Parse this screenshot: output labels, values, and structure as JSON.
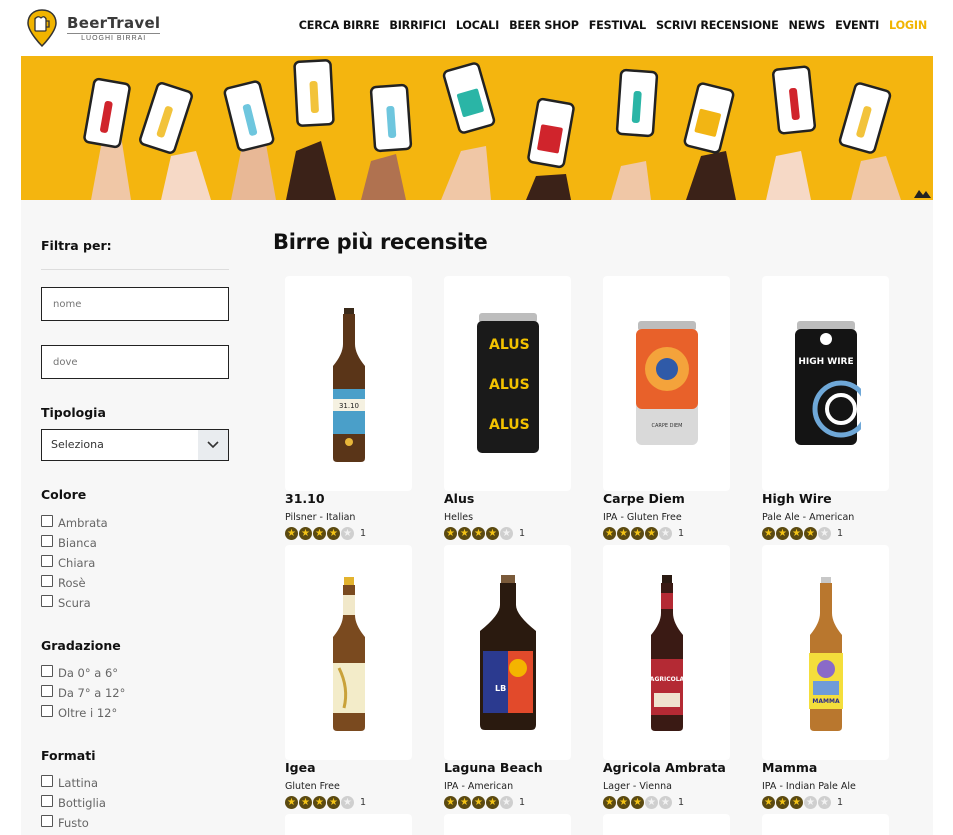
{
  "brand": {
    "name": "BeerTravel",
    "tagline": "LUOGHI BIRRAI"
  },
  "nav": [
    "CERCA BIRRE",
    "BIRRIFICI",
    "LOCALI",
    "BEER SHOP",
    "FESTIVAL",
    "SCRIVI RECENSIONE",
    "NEWS",
    "EVENTI",
    "LOGIN"
  ],
  "colors": {
    "accent": "#f1b400",
    "banner": "#f4b50f",
    "star_on": "#f3c316"
  },
  "sidebar": {
    "filter_title": "Filtra per:",
    "name_placeholder": "nome",
    "where_placeholder": "dove",
    "tipologia": {
      "title": "Tipologia",
      "selected": "Seleziona"
    },
    "colore": {
      "title": "Colore",
      "options": [
        "Ambrata",
        "Bianca",
        "Chiara",
        "Rosè",
        "Scura"
      ]
    },
    "gradazione": {
      "title": "Gradazione",
      "options": [
        "Da 0° a 6°",
        "Da 7° a 12°",
        "Oltre i 12°"
      ]
    },
    "formati": {
      "title": "Formati",
      "options": [
        "Lattina",
        "Bottiglia",
        "Fusto"
      ]
    }
  },
  "main": {
    "title": "Birre più recensite",
    "beers": [
      {
        "name": "31.10",
        "style": "Pilsner - Italian",
        "rating": 4,
        "count": "1"
      },
      {
        "name": "Alus",
        "style": "Helles",
        "rating": 4,
        "count": "1"
      },
      {
        "name": "Carpe Diem",
        "style": "IPA - Gluten Free",
        "rating": 4,
        "count": "1"
      },
      {
        "name": "High Wire",
        "style": "Pale Ale - American",
        "rating": 4,
        "count": "1"
      },
      {
        "name": "Igea",
        "style": "Gluten Free",
        "rating": 4,
        "count": "1"
      },
      {
        "name": "Laguna Beach",
        "style": "IPA - American",
        "rating": 4,
        "count": "1"
      },
      {
        "name": "Agricola Ambrata",
        "style": "Lager - Vienna",
        "rating": 3,
        "count": "1"
      },
      {
        "name": "Mamma",
        "style": "IPA - Indian Pale Ale",
        "rating": 3,
        "count": "1"
      }
    ]
  }
}
